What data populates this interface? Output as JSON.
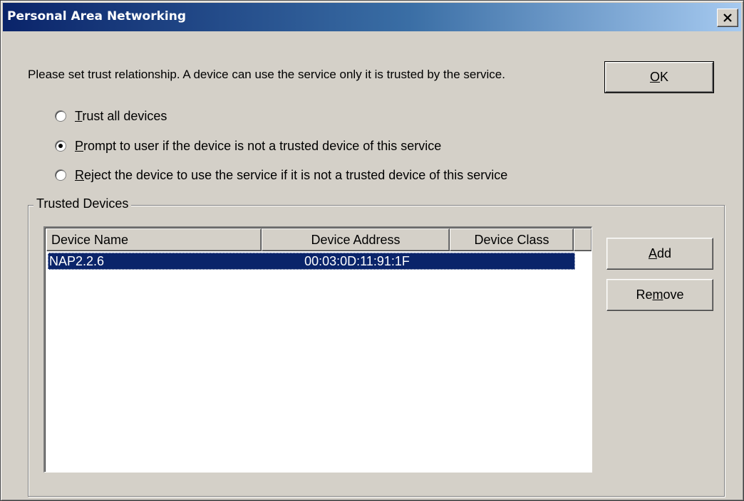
{
  "window": {
    "title": "Personal Area Networking",
    "close_icon": "close-icon"
  },
  "instruction": "Please set trust relationship. A device can use the service only  it is trusted by the service.",
  "buttons": {
    "ok": {
      "mnemonic": "O",
      "rest": "K"
    },
    "add": {
      "mnemonic": "A",
      "rest": "dd"
    },
    "remove": {
      "pre": "Re",
      "mnemonic": "m",
      "rest": "ove"
    }
  },
  "trust_options": [
    {
      "mnemonic": "T",
      "rest": "rust all devices",
      "selected": false
    },
    {
      "mnemonic": "P",
      "rest": "rompt to user if the device is not a trusted device of this service",
      "selected": true
    },
    {
      "mnemonic": "R",
      "rest": "eject the device to use the service if it is not a trusted device of this service",
      "selected": false
    }
  ],
  "trusted_devices": {
    "group_label": "Trusted Devices",
    "columns": [
      "Device Name",
      "Device Address",
      "Device Class"
    ],
    "rows": [
      {
        "name": "NAP2.2.6",
        "address": "00:03:0D:11:91:1F",
        "class": "",
        "selected": true
      }
    ]
  },
  "colors": {
    "title_gradient_start": "#0a246a",
    "title_gradient_end": "#a6caf0",
    "selection": "#0a246a",
    "face": "#d4d0c8"
  }
}
